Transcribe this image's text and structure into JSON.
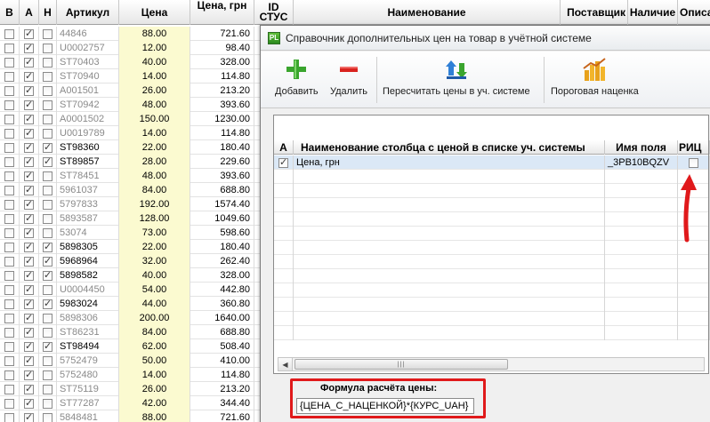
{
  "grid": {
    "headers": {
      "b": "В",
      "a": "А",
      "n": "Н",
      "article": "Артикул",
      "price": "Цена",
      "price_uah": "Цена, грн",
      "id_stus": "ID СТУС",
      "name": "Наименование",
      "supplier": "Поставщик",
      "stock": "Наличие",
      "desc": "Описа"
    },
    "rows": [
      {
        "b": false,
        "a": true,
        "n": false,
        "article": "44846",
        "gray": true,
        "price": "88.00",
        "uah": "721.60"
      },
      {
        "b": false,
        "a": true,
        "n": false,
        "article": "U0002757",
        "gray": true,
        "price": "12.00",
        "uah": "98.40"
      },
      {
        "b": false,
        "a": true,
        "n": false,
        "article": "ST70403",
        "gray": true,
        "price": "40.00",
        "uah": "328.00"
      },
      {
        "b": false,
        "a": true,
        "n": false,
        "article": "ST70940",
        "gray": true,
        "price": "14.00",
        "uah": "114.80"
      },
      {
        "b": false,
        "a": true,
        "n": false,
        "article": "A001501",
        "gray": true,
        "price": "26.00",
        "uah": "213.20"
      },
      {
        "b": false,
        "a": true,
        "n": false,
        "article": "ST70942",
        "gray": true,
        "price": "48.00",
        "uah": "393.60"
      },
      {
        "b": false,
        "a": true,
        "n": false,
        "article": "A0001502",
        "gray": true,
        "price": "150.00",
        "uah": "1230.00"
      },
      {
        "b": false,
        "a": true,
        "n": false,
        "article": "U0019789",
        "gray": true,
        "price": "14.00",
        "uah": "114.80"
      },
      {
        "b": false,
        "a": true,
        "n": true,
        "article": "ST98360",
        "gray": false,
        "price": "22.00",
        "uah": "180.40"
      },
      {
        "b": false,
        "a": true,
        "n": true,
        "article": "ST89857",
        "gray": false,
        "price": "28.00",
        "uah": "229.60"
      },
      {
        "b": false,
        "a": true,
        "n": false,
        "article": "ST78451",
        "gray": true,
        "price": "48.00",
        "uah": "393.60"
      },
      {
        "b": false,
        "a": true,
        "n": false,
        "article": "5961037",
        "gray": true,
        "price": "84.00",
        "uah": "688.80"
      },
      {
        "b": false,
        "a": true,
        "n": false,
        "article": "5797833",
        "gray": true,
        "price": "192.00",
        "uah": "1574.40"
      },
      {
        "b": false,
        "a": true,
        "n": false,
        "article": "5893587",
        "gray": true,
        "price": "128.00",
        "uah": "1049.60"
      },
      {
        "b": false,
        "a": true,
        "n": false,
        "article": "53074",
        "gray": true,
        "price": "73.00",
        "uah": "598.60"
      },
      {
        "b": false,
        "a": true,
        "n": true,
        "article": "5898305",
        "gray": false,
        "price": "22.00",
        "uah": "180.40"
      },
      {
        "b": false,
        "a": true,
        "n": true,
        "article": "5968964",
        "gray": false,
        "price": "32.00",
        "uah": "262.40"
      },
      {
        "b": false,
        "a": true,
        "n": true,
        "article": "5898582",
        "gray": false,
        "price": "40.00",
        "uah": "328.00"
      },
      {
        "b": false,
        "a": true,
        "n": false,
        "article": "U0004450",
        "gray": true,
        "price": "54.00",
        "uah": "442.80"
      },
      {
        "b": false,
        "a": true,
        "n": true,
        "article": "5983024",
        "gray": false,
        "price": "44.00",
        "uah": "360.80"
      },
      {
        "b": false,
        "a": true,
        "n": false,
        "article": "5898306",
        "gray": true,
        "price": "200.00",
        "uah": "1640.00"
      },
      {
        "b": false,
        "a": true,
        "n": false,
        "article": "ST86231",
        "gray": true,
        "price": "84.00",
        "uah": "688.80"
      },
      {
        "b": false,
        "a": true,
        "n": true,
        "article": "ST98494",
        "gray": false,
        "price": "62.00",
        "uah": "508.40"
      },
      {
        "b": false,
        "a": true,
        "n": false,
        "article": "5752479",
        "gray": true,
        "price": "50.00",
        "uah": "410.00"
      },
      {
        "b": false,
        "a": true,
        "n": false,
        "article": "5752480",
        "gray": true,
        "price": "14.00",
        "uah": "114.80"
      },
      {
        "b": false,
        "a": true,
        "n": false,
        "article": "ST75119",
        "gray": true,
        "price": "26.00",
        "uah": "213.20"
      },
      {
        "b": false,
        "a": true,
        "n": false,
        "article": "ST77287",
        "gray": true,
        "price": "42.00",
        "uah": "344.40"
      },
      {
        "b": false,
        "a": true,
        "n": false,
        "article": "5848481",
        "gray": true,
        "price": "88.00",
        "uah": "721.60"
      }
    ]
  },
  "dialog": {
    "title": "Справочник дополнительных цен на товар в учётной системе",
    "toolbar": {
      "add": "Добавить",
      "delete": "Удалить",
      "recalc": "Пересчитать цены в уч. системе",
      "threshold": "Пороговая наценка"
    },
    "table": {
      "headers": {
        "a": "А",
        "name": "Наименование столбца с ценой в списке уч. системы",
        "field": "Имя поля",
        "extra": "РИЦ"
      },
      "rows": [
        {
          "a": true,
          "name": "Цена, грн",
          "field": "_3PB10BQZV",
          "extra": false
        }
      ]
    },
    "formula": {
      "label": "Формула расчёта цены:",
      "value": "{ЦЕНА_С_НАЦЕНКОЙ}*{КУРС_UAH}"
    }
  }
}
